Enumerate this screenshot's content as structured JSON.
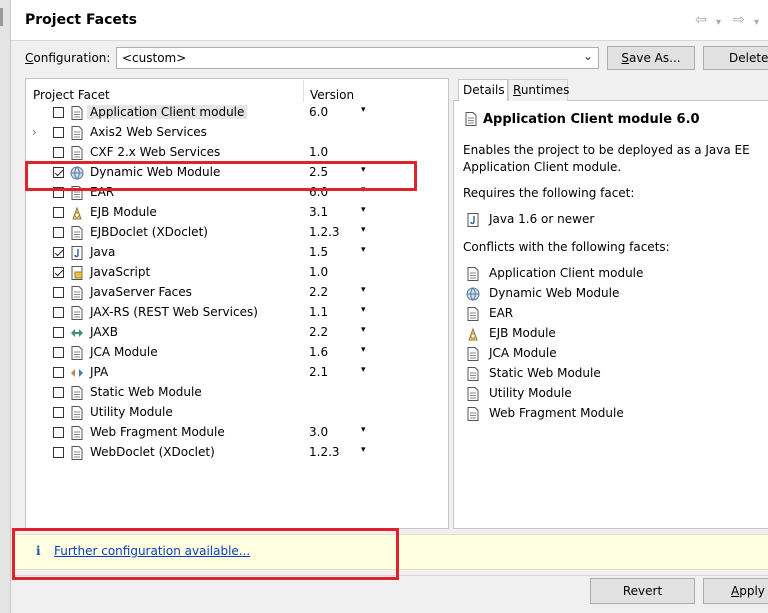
{
  "page": {
    "title": "Project Facets"
  },
  "toolbar": {
    "back_arrow": "⇦",
    "back_dd": "▾",
    "fwd_arrow": "⇨",
    "fwd_dd": "▾"
  },
  "configuration": {
    "label_prefix": "",
    "label_mnemonic": "C",
    "label_rest": "onfiguration:",
    "value": "<custom>",
    "dropdown_arrow": "⌄",
    "save_as_mnemonic": "S",
    "save_as_rest": "ave As...",
    "delete_label": "Delete"
  },
  "facets": {
    "col_facet": "Project Facet",
    "col_version": "Version",
    "rows": [
      {
        "name": "Application Client module",
        "version": "6.0",
        "checked": false,
        "icon": "page-icon",
        "dropdown": "▾",
        "expander": ""
      },
      {
        "name": "Axis2 Web Services",
        "version": "",
        "checked": false,
        "icon": "page-icon",
        "dropdown": "",
        "expander": "›"
      },
      {
        "name": "CXF 2.x Web Services",
        "version": "1.0",
        "checked": false,
        "icon": "page-icon",
        "dropdown": "",
        "expander": ""
      },
      {
        "name": "Dynamic Web Module",
        "version": "2.5",
        "checked": true,
        "icon": "globe-icon",
        "dropdown": "▾",
        "expander": ""
      },
      {
        "name": "EAR",
        "version": "6.0",
        "checked": false,
        "icon": "page-icon",
        "dropdown": "▾",
        "expander": ""
      },
      {
        "name": "EJB Module",
        "version": "3.1",
        "checked": false,
        "icon": "bean-icon",
        "dropdown": "▾",
        "expander": ""
      },
      {
        "name": "EJBDoclet (XDoclet)",
        "version": "1.2.3",
        "checked": false,
        "icon": "page-icon",
        "dropdown": "▾",
        "expander": ""
      },
      {
        "name": "Java",
        "version": "1.5",
        "checked": true,
        "icon": "java-icon",
        "dropdown": "▾",
        "expander": ""
      },
      {
        "name": "JavaScript",
        "version": "1.0",
        "checked": true,
        "icon": "js-icon",
        "dropdown": "",
        "expander": ""
      },
      {
        "name": "JavaServer Faces",
        "version": "2.2",
        "checked": false,
        "icon": "page-icon",
        "dropdown": "▾",
        "expander": ""
      },
      {
        "name": "JAX-RS (REST Web Services)",
        "version": "1.1",
        "checked": false,
        "icon": "page-icon",
        "dropdown": "▾",
        "expander": ""
      },
      {
        "name": "JAXB",
        "version": "2.2",
        "checked": false,
        "icon": "jaxb-icon",
        "dropdown": "▾",
        "expander": ""
      },
      {
        "name": "JCA Module",
        "version": "1.6",
        "checked": false,
        "icon": "page-icon",
        "dropdown": "▾",
        "expander": ""
      },
      {
        "name": "JPA",
        "version": "2.1",
        "checked": false,
        "icon": "jpa-icon",
        "dropdown": "▾",
        "expander": ""
      },
      {
        "name": "Static Web Module",
        "version": "",
        "checked": false,
        "icon": "page-icon",
        "dropdown": "",
        "expander": ""
      },
      {
        "name": "Utility Module",
        "version": "",
        "checked": false,
        "icon": "page-icon",
        "dropdown": "",
        "expander": ""
      },
      {
        "name": "Web Fragment Module",
        "version": "3.0",
        "checked": false,
        "icon": "page-icon",
        "dropdown": "▾",
        "expander": ""
      },
      {
        "name": "WebDoclet (XDoclet)",
        "version": "1.2.3",
        "checked": false,
        "icon": "page-icon",
        "dropdown": "▾",
        "expander": ""
      }
    ]
  },
  "details": {
    "tab_details": "Details",
    "tab_runtimes_mnemonic": "R",
    "tab_runtimes_rest": "untimes",
    "title": "Application Client module 6.0",
    "description": "Enables the project to be deployed as a Java EE Application Client module.",
    "requires_label": "Requires the following facet:",
    "requires": [
      {
        "name": "Java 1.6 or newer",
        "icon": "java-icon"
      }
    ],
    "conflicts_label": "Conflicts with the following facets:",
    "conflicts": [
      {
        "name": "Application Client module",
        "icon": "page-icon"
      },
      {
        "name": "Dynamic Web Module",
        "icon": "globe-icon"
      },
      {
        "name": "EAR",
        "icon": "page-icon"
      },
      {
        "name": "EJB Module",
        "icon": "bean-icon"
      },
      {
        "name": "JCA Module",
        "icon": "page-icon"
      },
      {
        "name": "Static Web Module",
        "icon": "page-icon"
      },
      {
        "name": "Utility Module",
        "icon": "page-icon"
      },
      {
        "name": "Web Fragment Module",
        "icon": "page-icon"
      }
    ]
  },
  "banner": {
    "info_glyph": "i",
    "link": "Further configuration available..."
  },
  "buttons": {
    "revert": "Revert",
    "apply_mnemonic": "A",
    "apply_rest": "pply"
  },
  "colors": {
    "highlight": "#e0222c",
    "link": "#0b3cc1",
    "banner_bg": "#ffffe1"
  }
}
